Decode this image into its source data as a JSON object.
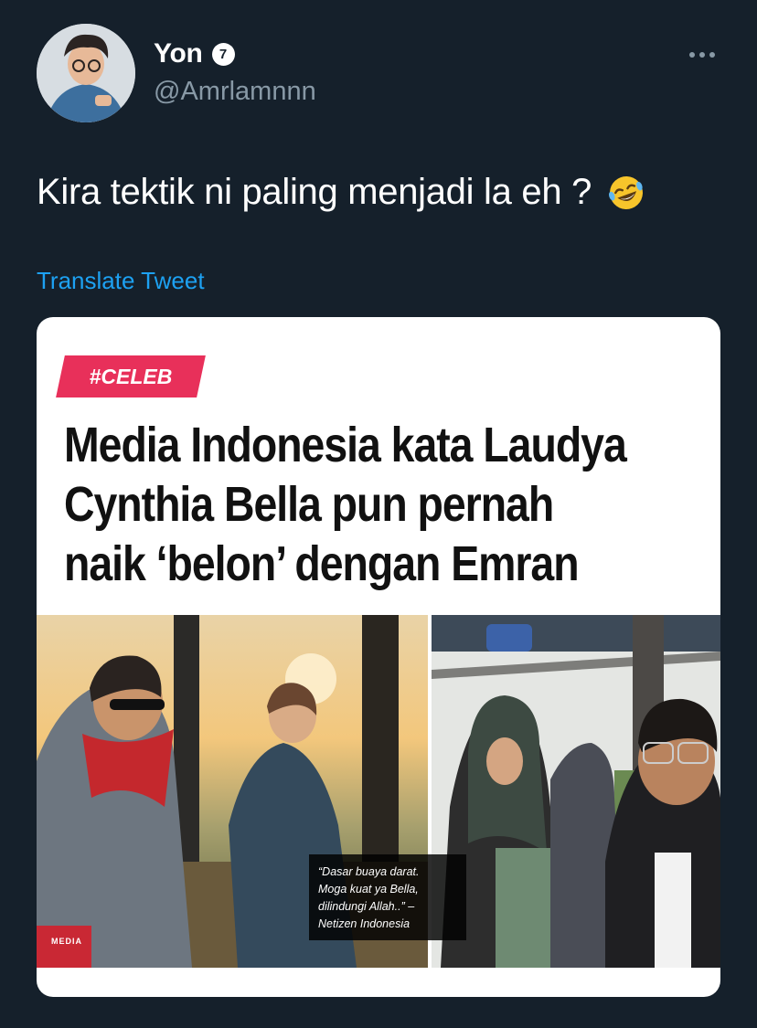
{
  "user": {
    "display_name": "Yon",
    "badge": "7",
    "handle": "@Amrlamnnn"
  },
  "tweet": {
    "text": "Kira tektik ni paling menjadi la eh ?",
    "emoji": "rolling-on-floor-laughing-face",
    "translate_label": "Translate Tweet"
  },
  "media": {
    "tag": "#CELEB",
    "headline": [
      "Media Indonesia kata Laudya",
      "Cynthia Bella pun pernah",
      "naik ‘belon’ dengan Emran"
    ],
    "quote": [
      "“Dasar buaya darat.",
      "Moga kuat ya Bella,",
      "dilindungi Allah..” –",
      "Netizen Indonesia"
    ],
    "logo": "MEDIA",
    "colors": {
      "tag": "#e8305a",
      "headline": "#111111"
    }
  },
  "colors": {
    "background": "#15202b",
    "link": "#1da1f2",
    "muted": "#8899a6"
  }
}
